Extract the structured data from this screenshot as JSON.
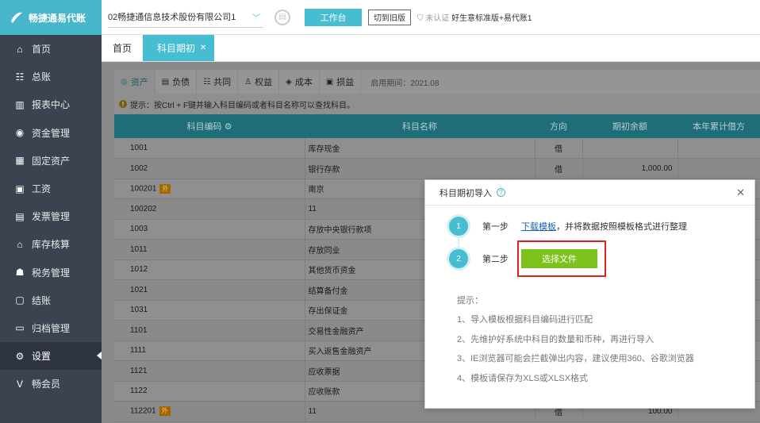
{
  "app": {
    "brand": "畅捷通易代账"
  },
  "sidebar": {
    "items": [
      {
        "label": "首页",
        "icon": "home-icon"
      },
      {
        "label": "总账",
        "icon": "ledger-icon"
      },
      {
        "label": "报表中心",
        "icon": "report-icon"
      },
      {
        "label": "资金管理",
        "icon": "fund-icon"
      },
      {
        "label": "固定资产",
        "icon": "asset-icon"
      },
      {
        "label": "工资",
        "icon": "salary-icon"
      },
      {
        "label": "发票管理",
        "icon": "invoice-icon"
      },
      {
        "label": "库存核算",
        "icon": "inventory-icon"
      },
      {
        "label": "税务管理",
        "icon": "tax-icon"
      },
      {
        "label": "结账",
        "icon": "closing-icon"
      },
      {
        "label": "归档管理",
        "icon": "archive-icon"
      },
      {
        "label": "设置",
        "icon": "gear-icon"
      },
      {
        "label": "畅会员",
        "icon": "member-icon"
      }
    ],
    "active_index": 11
  },
  "topbar": {
    "company": "02畅捷通信息技术股份有限公司1",
    "workbench": "工作台",
    "switch_old": "切到旧版",
    "cert": "未认证",
    "tenant": "好生意标准版+易代账1"
  },
  "tabs": {
    "home": "首页",
    "active": "科目期初"
  },
  "subtabs": [
    {
      "label": "资产",
      "icon": "asset-tab-icon"
    },
    {
      "label": "负债",
      "icon": "liability-tab-icon"
    },
    {
      "label": "共同",
      "icon": "common-tab-icon"
    },
    {
      "label": "权益",
      "icon": "equity-tab-icon"
    },
    {
      "label": "成本",
      "icon": "cost-tab-icon"
    },
    {
      "label": "损益",
      "icon": "pl-tab-icon"
    }
  ],
  "start_date": "启用期间：2021.08",
  "tip": "提示：按Ctrl + F键并输入科目编码或者科目名称可以查找科目。",
  "table": {
    "headers": [
      "科目编码",
      "科目名称",
      "方向",
      "期初余额",
      "本年累计借方"
    ],
    "rows": [
      {
        "code": "1001",
        "name": "库存现金",
        "dir": "借",
        "bal": "",
        "aux": ""
      },
      {
        "code": "1002",
        "name": "银行存款",
        "dir": "借",
        "bal": "1,000.00",
        "aux": ""
      },
      {
        "code": "100201",
        "name": "南京",
        "dir": "",
        "bal": "",
        "aux": "外"
      },
      {
        "code": "100202",
        "name": "11",
        "dir": "",
        "bal": "",
        "aux": ""
      },
      {
        "code": "1003",
        "name": "存放中央银行款项",
        "dir": "",
        "bal": "",
        "aux": ""
      },
      {
        "code": "1011",
        "name": "存放同业",
        "dir": "",
        "bal": "",
        "aux": ""
      },
      {
        "code": "1012",
        "name": "其他货币资金",
        "dir": "",
        "bal": "",
        "aux": ""
      },
      {
        "code": "1021",
        "name": "结算备付金",
        "dir": "",
        "bal": "",
        "aux": ""
      },
      {
        "code": "1031",
        "name": "存出保证金",
        "dir": "",
        "bal": "",
        "aux": ""
      },
      {
        "code": "1101",
        "name": "交易性金融资产",
        "dir": "",
        "bal": "",
        "aux": ""
      },
      {
        "code": "1111",
        "name": "买入返售金融资产",
        "dir": "",
        "bal": "",
        "aux": ""
      },
      {
        "code": "1121",
        "name": "应收票据",
        "dir": "",
        "bal": "",
        "aux": ""
      },
      {
        "code": "1122",
        "name": "应收账款",
        "dir": "",
        "bal": "",
        "aux": ""
      },
      {
        "code": "112201",
        "name": "11",
        "dir": "借",
        "bal": "100.00",
        "aux": "外"
      }
    ]
  },
  "modal": {
    "title": "科目期初导入",
    "step1_num": "1",
    "step1_label": "第一步",
    "step1_link": "下载模板",
    "step1_text": "，并将数据按照模板格式进行整理",
    "step2_num": "2",
    "step2_label": "第二步",
    "choose_file": "选择文件",
    "hint_title": "提示：",
    "hints": [
      "1、导入模板根据科目编码进行匹配",
      "2、先维护好系统中科目的数量和币种，再进行导入",
      "3、IE浏览器可能会拦截弹出内容，建议使用360、谷歌浏览器",
      "4、模板请保存为XLS或XLSX格式"
    ]
  }
}
